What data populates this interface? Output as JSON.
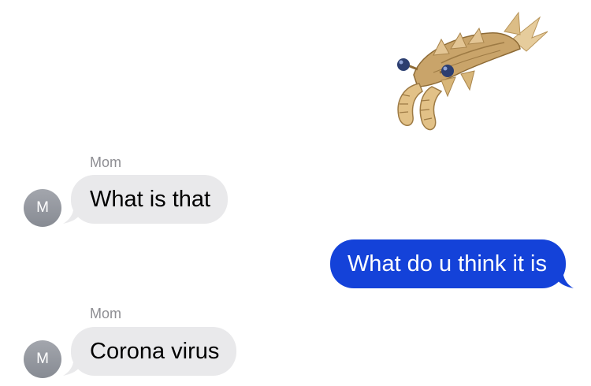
{
  "thread": {
    "sticker": {
      "icon": "anomalocaris-sticker",
      "colors": {
        "body": "#c9a46a",
        "eye": "#2c3e70",
        "fin": "#e3c594"
      }
    },
    "messages": [
      {
        "sender_name": "Mom",
        "avatar_initial": "M",
        "text": "What is that"
      },
      {
        "text": "What do u think it is"
      },
      {
        "sender_name": "Mom",
        "avatar_initial": "M",
        "text": "Corona virus"
      }
    ]
  },
  "colors": {
    "incoming_bubble": "#e9e9eb",
    "outgoing_bubble": "#1442d9",
    "avatar": "#8e9198",
    "sender_name": "#8e8e93"
  }
}
